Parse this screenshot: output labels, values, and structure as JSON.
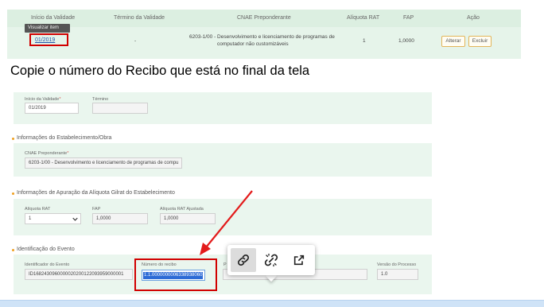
{
  "table": {
    "headers": [
      "Início da Validade",
      "Término da Validade",
      "CNAE Preponderante",
      "Alíquota RAT",
      "FAP",
      "Ação"
    ],
    "tooltip": "Visualizar item",
    "row": {
      "inicio": "01/2019",
      "termino": "-",
      "cnae_line1": "6203-1/00 - Desenvolvimento e licenciamento de programas de",
      "cnae_line2": "computador não customizáveis",
      "aliquota": "1",
      "fap": "1,0000"
    },
    "actions": {
      "alterar": "Alterar",
      "excluir": "Excluir"
    }
  },
  "instruction": "Copie o número  do Recibo que está no final da tela",
  "validade": {
    "inicio_label": "Início da Validade",
    "inicio_value": "01/2019",
    "termino_label": "Término",
    "termino_value": ""
  },
  "estabelecimento": {
    "title": "Informações do Estabelecimento/Obra",
    "cnae_label": "CNAE Preponderante",
    "cnae_value": "6203-1/00 - Desenvolvimento e licenciamento de programas de compu"
  },
  "apuracao": {
    "title": "Informações de Apuração da Alíquota Gilrat do Estabelecimento",
    "rat_label": "Alíquota RAT",
    "rat_value": "1",
    "fap_label": "FAP",
    "fap_value": "1,0000",
    "rat_ajustada_label": "Alíquota RAT Ajustada",
    "rat_ajustada_value": "1,0000"
  },
  "evento": {
    "title": "Identificação do Evento",
    "id_label": "Identificador do Evento",
    "id_value": "ID1682430960000020200122093959000001",
    "recibo_label": "Número do recibo",
    "recibo_value": "1.1.0000000006338938060",
    "versao_label": "Versão do Processo",
    "versao_value": "1.0",
    "hidden_label": "P"
  },
  "popup": {
    "icons": [
      "link-icon",
      "unlink-icon",
      "open-external-icon"
    ]
  },
  "colors": {
    "panel": "#eaf6ee",
    "highlight": "#d10000",
    "arrow": "#e31b1b",
    "selection": "#2d6bd6"
  }
}
